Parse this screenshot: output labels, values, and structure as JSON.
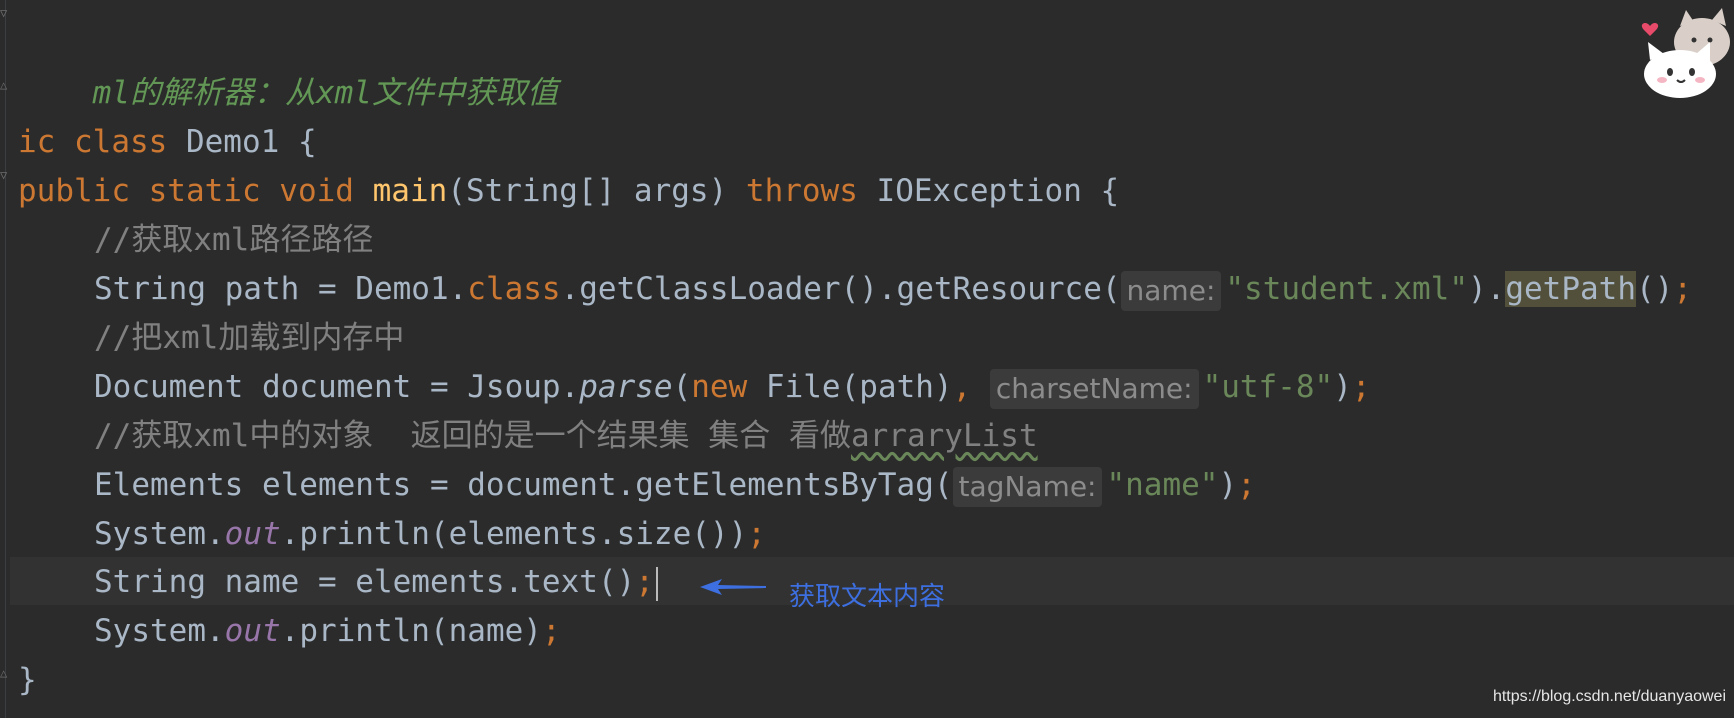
{
  "code": {
    "line1": {
      "doc": "ml的解析器：从xml文件中获取值"
    },
    "line3": {
      "kw": "ic class",
      "rest": " Demo1 {"
    },
    "line4": {
      "kw1": "public static void",
      "fn": "main",
      "params": "(String[] args) ",
      "kw2": "throws",
      "rest": " IOException {"
    },
    "line5": {
      "comment": "//获取xml路径路径"
    },
    "line6": {
      "prefix": "String path = Demo1.",
      "kw": "class",
      "middle": ".getClassLoader().getResource(",
      "hint": "name:",
      "str": "\"student.xml\"",
      "after_str": ").",
      "highlight": "getPath",
      "tail": "()",
      "semi": ";"
    },
    "line7": {
      "comment": "//把xml加载到内存中"
    },
    "line8": {
      "prefix": "Document document = Jsoup.",
      "method": "parse",
      "open": "(",
      "kw": "new",
      "middle": " File(path)",
      "comma": ", ",
      "hint": "charsetName:",
      "str": "\"utf-8\"",
      "close": ")",
      "semi": ";"
    },
    "line9": {
      "comment": "//获取xml中的对象  返回的是一个结果集 集合 看做",
      "typo": "arraryList"
    },
    "line10": {
      "prefix": "Elements elements = document.getElementsByTag(",
      "hint": "tagName:",
      "str": "\"name\"",
      "close": ")",
      "semi": ";"
    },
    "line11": {
      "prefix": "System.",
      "field": "out",
      "rest": ".println(elements.size())",
      "semi": ";"
    },
    "line12": {
      "prefix": "String name = elements.text()",
      "semi": ";"
    },
    "line13": {
      "prefix": "System.",
      "field": "out",
      "rest": ".println(name)",
      "semi": ";"
    },
    "line14": {
      "brace": "}"
    }
  },
  "annotation": {
    "text": "获取文本内容",
    "color": "#3d6fe0"
  },
  "watermark": "https://blog.csdn.net/duanyaowei",
  "icons": [
    "fold-marker-icon",
    "arrow-left-icon",
    "cat-mascot-icon"
  ],
  "colors": {
    "background": "#2b2b2b",
    "keyword": "#cc7832",
    "string": "#6a8759",
    "comment": "#808080",
    "method_decl": "#ffc66d",
    "static_field": "#9876aa"
  }
}
